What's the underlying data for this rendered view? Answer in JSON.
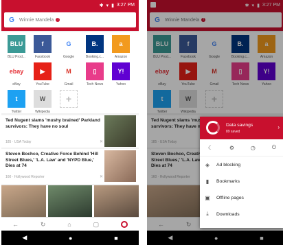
{
  "status": {
    "time": "3:27 PM"
  },
  "search": {
    "url_text": "Winnie Mandela"
  },
  "speed_dial": [
    {
      "label": "BLU Prod...",
      "icon": "blu-icon",
      "color": "#3b9a96",
      "glyph": "BLU"
    },
    {
      "label": "Facebook",
      "icon": "facebook-icon",
      "color": "#3b5998",
      "glyph": "f"
    },
    {
      "label": "Google",
      "icon": "google-icon",
      "color": "#ffffff",
      "glyph": "G"
    },
    {
      "label": "Booking.c...",
      "icon": "booking-icon",
      "color": "#003580",
      "glyph": "B."
    },
    {
      "label": "Amazon",
      "icon": "amazon-icon",
      "color": "#f29a1e",
      "glyph": "a"
    },
    {
      "label": "eBay",
      "icon": "ebay-icon",
      "color": "#ffffff",
      "glyph": "ebay"
    },
    {
      "label": "YouTube",
      "icon": "youtube-icon",
      "color": "#e62117",
      "glyph": "▶"
    },
    {
      "label": "Gmail",
      "icon": "gmail-icon",
      "color": "#ffffff",
      "glyph": "M"
    },
    {
      "label": "Tech News",
      "icon": "technews-icon",
      "color": "#e83c8a",
      "glyph": "▯"
    },
    {
      "label": "Yahoo",
      "icon": "yahoo-icon",
      "color": "#6001d2",
      "glyph": "Y!"
    },
    {
      "label": "Twitter",
      "icon": "twitter-icon",
      "color": "#1da1f2",
      "glyph": "t"
    },
    {
      "label": "Wikipedia",
      "icon": "wikipedia-icon",
      "color": "#dddddd",
      "glyph": "W"
    },
    {
      "label": "",
      "icon": "add-icon",
      "color": "#ffffff",
      "glyph": "+"
    }
  ],
  "news": [
    {
      "headline": "Ted Nugent slams 'mushy brained' Parkland survivors: They have no soul",
      "meta": "185 · USA Today"
    },
    {
      "headline": "Steven Bochco, Creative Force Behind 'Hill Street Blues,' 'L.A. Law' and 'NYPD Blue,' Dies at 74",
      "meta": "160 · Hollywood Reporter"
    }
  ],
  "menu": {
    "savings_title": "Data savings",
    "savings_sub": "89 saved",
    "items": [
      {
        "label": "Ad blocking",
        "icon": "shield-icon"
      },
      {
        "label": "Bookmarks",
        "icon": "bookmark-icon"
      },
      {
        "label": "Offline pages",
        "icon": "offline-icon"
      },
      {
        "label": "Downloads",
        "icon": "download-icon"
      }
    ]
  },
  "colors": {
    "brand": "#c8102e"
  }
}
